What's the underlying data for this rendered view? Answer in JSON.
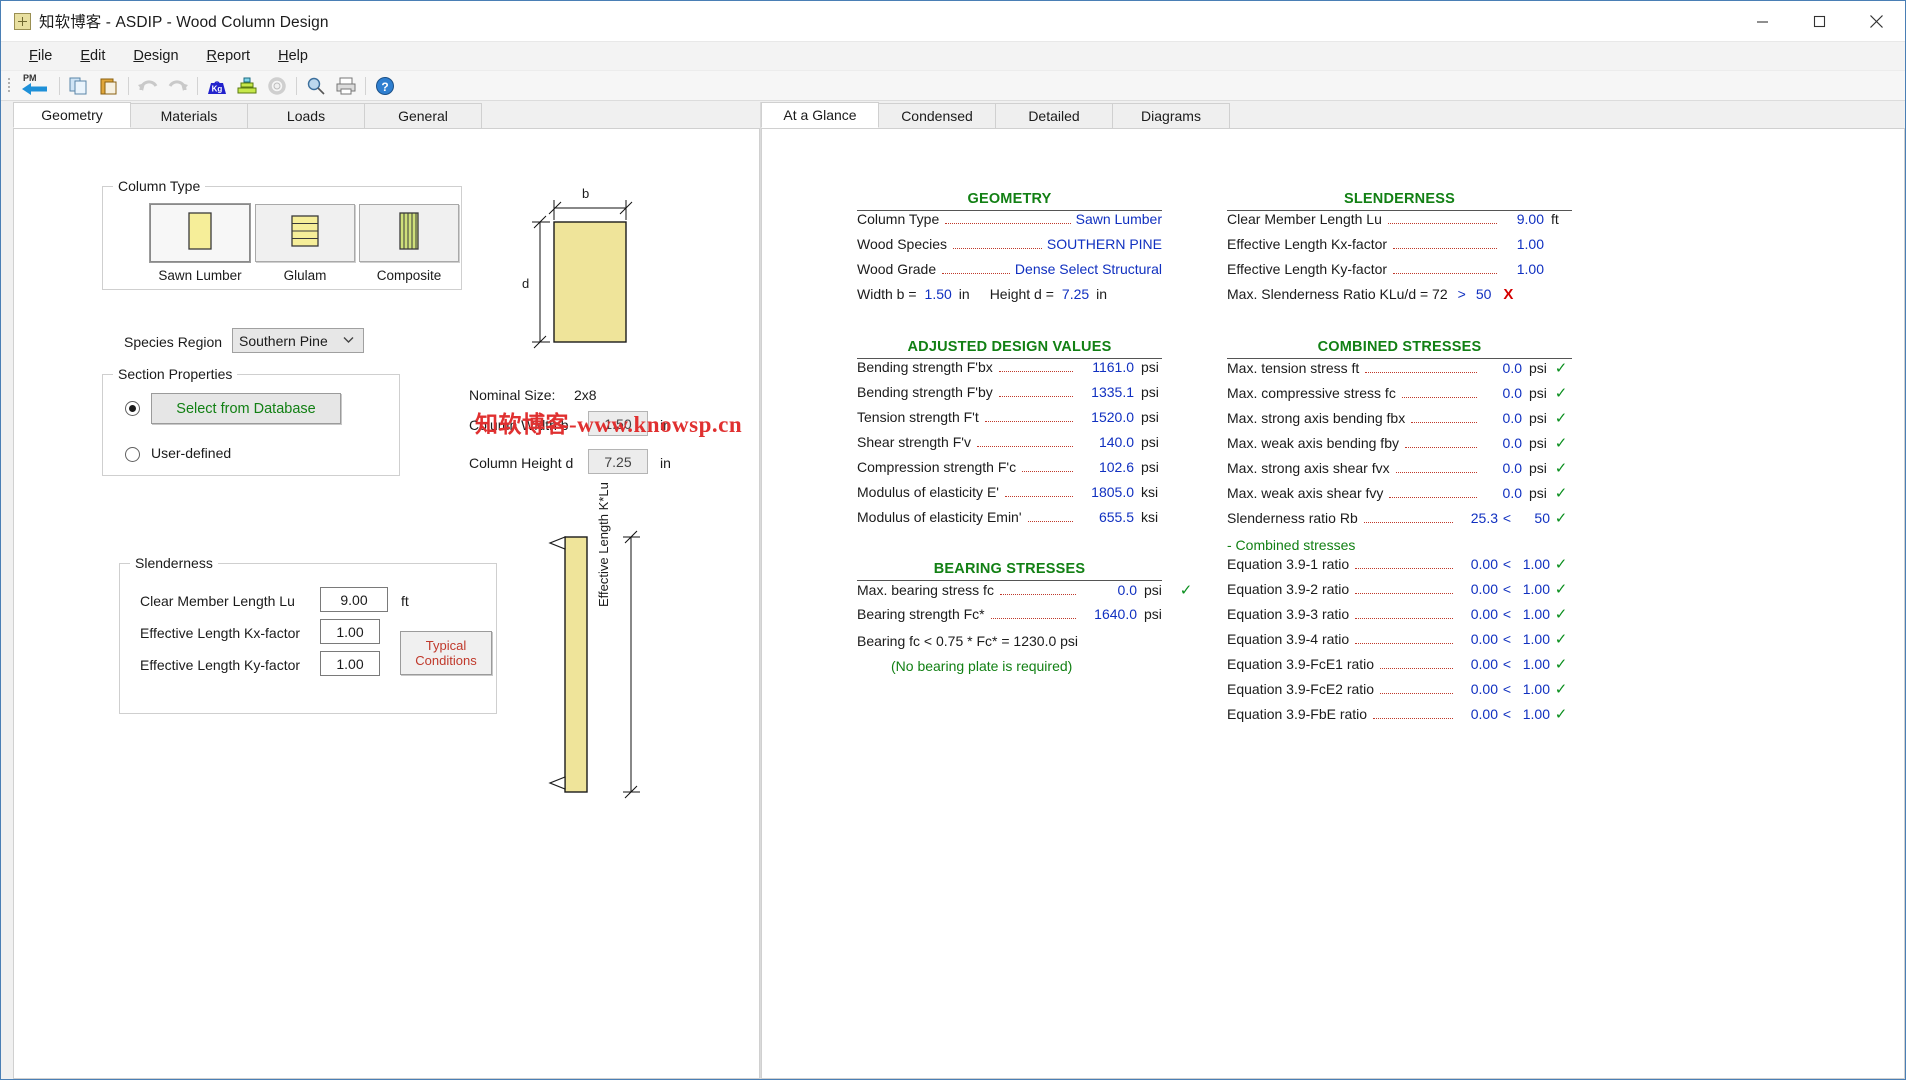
{
  "window": {
    "title": "知软博客 - ASDIP - Wood Column Design",
    "icon": "column-section-icon",
    "minimize": "minimize-icon",
    "maximize": "maximize-icon",
    "close": "close-icon"
  },
  "menubar": [
    {
      "label": "File",
      "accel": "F"
    },
    {
      "label": "Edit",
      "accel": "E"
    },
    {
      "label": "Design",
      "accel": "D"
    },
    {
      "label": "Report",
      "accel": "R"
    },
    {
      "label": "Help",
      "accel": "H"
    }
  ],
  "toolbar": [
    {
      "name": "back-pm-icon",
      "label": "PM"
    },
    {
      "name": "copy-icon"
    },
    {
      "name": "paste-icon"
    },
    {
      "name": "undo-icon"
    },
    {
      "name": "redo-icon"
    },
    {
      "name": "loads-kg-icon"
    },
    {
      "name": "design-stack-icon"
    },
    {
      "name": "settings-gear-icon"
    },
    {
      "name": "zoom-search-icon"
    },
    {
      "name": "print-icon"
    },
    {
      "name": "help-icon"
    }
  ],
  "left_tabs": [
    {
      "label": "Geometry",
      "active": true
    },
    {
      "label": "Materials",
      "active": false
    },
    {
      "label": "Loads",
      "active": false
    },
    {
      "label": "General",
      "active": false
    }
  ],
  "geometry": {
    "column_type": {
      "title": "Column Type",
      "options": [
        {
          "label": "Sawn Lumber",
          "icon": "solid-rect-icon",
          "selected": true
        },
        {
          "label": "Glulam",
          "icon": "laminated-layers-icon",
          "selected": false
        },
        {
          "label": "Composite",
          "icon": "vertical-strips-icon",
          "selected": false
        }
      ]
    },
    "species_region": {
      "label": "Species Region",
      "value": "Southern Pine"
    },
    "section_properties": {
      "title": "Section Properties",
      "select_from_database": "Select from Database",
      "select_from_database_selected": true,
      "user_defined": "User-defined",
      "user_defined_selected": false
    },
    "section_diagram": {
      "width_symbol": "b",
      "depth_symbol": "d"
    },
    "nominal": {
      "label": "Nominal Size:",
      "value": "2x8"
    },
    "column_width": {
      "label": "Column Width  b",
      "value": "1.50",
      "unit": "in"
    },
    "column_height": {
      "label": "Column Height  d",
      "value": "7.25",
      "unit": "in"
    },
    "slenderness": {
      "title": "Slenderness",
      "rows": [
        {
          "label": "Clear Member Length  Lu",
          "value": "9.00",
          "unit": "ft"
        },
        {
          "label": "Effective Length Kx-factor",
          "value": "1.00",
          "unit": ""
        },
        {
          "label": "Effective Length Ky-factor",
          "value": "1.00",
          "unit": ""
        }
      ],
      "typical_button_line1": "Typical",
      "typical_button_line2": "Conditions"
    },
    "elevation_diagram": {
      "caption": "Effective Length K*Lu"
    }
  },
  "right_tabs": [
    {
      "label": "At a Glance",
      "active": true
    },
    {
      "label": "Condensed",
      "active": false
    },
    {
      "label": "Detailed",
      "active": false
    },
    {
      "label": "Diagrams",
      "active": false
    }
  ],
  "results": {
    "geometry": {
      "title": "GEOMETRY",
      "rows": [
        {
          "label": "Column Type",
          "value": "Sawn Lumber",
          "unit": ""
        },
        {
          "label": "Wood Species",
          "value": "SOUTHERN PINE",
          "unit": ""
        },
        {
          "label": "Wood Grade",
          "value": "Dense Select Structural",
          "unit": ""
        }
      ],
      "inline": {
        "width_label": "Width  b =",
        "width_value": "1.50",
        "width_unit": "in",
        "height_label": "Height  d =",
        "height_value": "7.25",
        "height_unit": "in"
      }
    },
    "adjusted_design_values": {
      "title": "ADJUSTED DESIGN VALUES",
      "rows": [
        {
          "label": "Bending strength  F'bx",
          "value": "1161.0",
          "unit": "psi"
        },
        {
          "label": "Bending strength  F'by",
          "value": "1335.1",
          "unit": "psi"
        },
        {
          "label": "Tension strength  F't",
          "value": "1520.0",
          "unit": "psi"
        },
        {
          "label": "Shear strength  F'v",
          "value": "140.0",
          "unit": "psi"
        },
        {
          "label": "Compression strength  F'c",
          "value": "102.6",
          "unit": "psi"
        },
        {
          "label": "Modulus of elasticity  E'",
          "value": "1805.0",
          "unit": "ksi"
        },
        {
          "label": "Modulus of elasticity  Emin'",
          "value": "655.5",
          "unit": "ksi"
        }
      ]
    },
    "bearing_stresses": {
      "title": "BEARING STRESSES",
      "rows": [
        {
          "label": "Max. bearing stress  fc",
          "value": "0.0",
          "unit": "psi",
          "check": "✓"
        },
        {
          "label": "Bearing strength  Fc*",
          "value": "1640.0",
          "unit": "psi",
          "check": ""
        }
      ],
      "note_line": "Bearing fc  <  0.75 * Fc* = 1230.0 psi",
      "note_green": "(No bearing plate is required)"
    },
    "slenderness": {
      "title": "SLENDERNESS",
      "rows": [
        {
          "label": "Clear Member Length  Lu",
          "value": "9.00",
          "unit": "ft"
        },
        {
          "label": "Effective Length  Kx-factor",
          "value": "1.00",
          "unit": ""
        },
        {
          "label": "Effective Length  Ky-factor",
          "value": "1.00",
          "unit": ""
        }
      ],
      "ratio_label": "Max. Slenderness Ratio  KLu/d = 72",
      "ratio_cmp": ">",
      "ratio_limit": "50",
      "ratio_flag": "X"
    },
    "combined_stresses": {
      "title": "COMBINED STRESSES",
      "rows": [
        {
          "label": "Max. tension stress  ft",
          "value": "0.0",
          "unit": "psi",
          "cmp": "",
          "limit": "",
          "check": "✓"
        },
        {
          "label": "Max. compressive stress  fc",
          "value": "0.0",
          "unit": "psi",
          "cmp": "",
          "limit": "",
          "check": "✓"
        },
        {
          "label": "Max. strong axis bending  fbx",
          "value": "0.0",
          "unit": "psi",
          "cmp": "",
          "limit": "",
          "check": "✓"
        },
        {
          "label": "Max. weak axis bending  fby",
          "value": "0.0",
          "unit": "psi",
          "cmp": "",
          "limit": "",
          "check": "✓"
        },
        {
          "label": "Max. strong axis shear  fvx",
          "value": "0.0",
          "unit": "psi",
          "cmp": "",
          "limit": "",
          "check": "✓"
        },
        {
          "label": "Max. weak axis shear  fvy",
          "value": "0.0",
          "unit": "psi",
          "cmp": "",
          "limit": "",
          "check": "✓"
        },
        {
          "label": "Slenderness ratio  Rb",
          "value": "25.3",
          "unit": "",
          "cmp": "<",
          "limit": "50",
          "check": "✓"
        }
      ],
      "subheading": "- Combined stresses",
      "equations": [
        {
          "label": "Equation 3.9-1 ratio",
          "value": "0.00",
          "cmp": "<",
          "limit": "1.00",
          "check": "✓"
        },
        {
          "label": "Equation 3.9-2 ratio",
          "value": "0.00",
          "cmp": "<",
          "limit": "1.00",
          "check": "✓"
        },
        {
          "label": "Equation 3.9-3 ratio",
          "value": "0.00",
          "cmp": "<",
          "limit": "1.00",
          "check": "✓"
        },
        {
          "label": "Equation 3.9-4 ratio",
          "value": "0.00",
          "cmp": "<",
          "limit": "1.00",
          "check": "✓"
        },
        {
          "label": "Equation 3.9-FcE1 ratio",
          "value": "0.00",
          "cmp": "<",
          "limit": "1.00",
          "check": "✓"
        },
        {
          "label": "Equation 3.9-FcE2 ratio",
          "value": "0.00",
          "cmp": "<",
          "limit": "1.00",
          "check": "✓"
        },
        {
          "label": "Equation 3.9-FbE ratio",
          "value": "0.00",
          "cmp": "<",
          "limit": "1.00",
          "check": "✓"
        }
      ]
    }
  },
  "watermark": "知软博客-www.knowsp.cn",
  "colors": {
    "accent_green": "#128014",
    "value_blue": "#1030c0",
    "fail_red": "#d40000",
    "dots_red": "#c0392b",
    "wood_yellow": "#f0e68c"
  }
}
